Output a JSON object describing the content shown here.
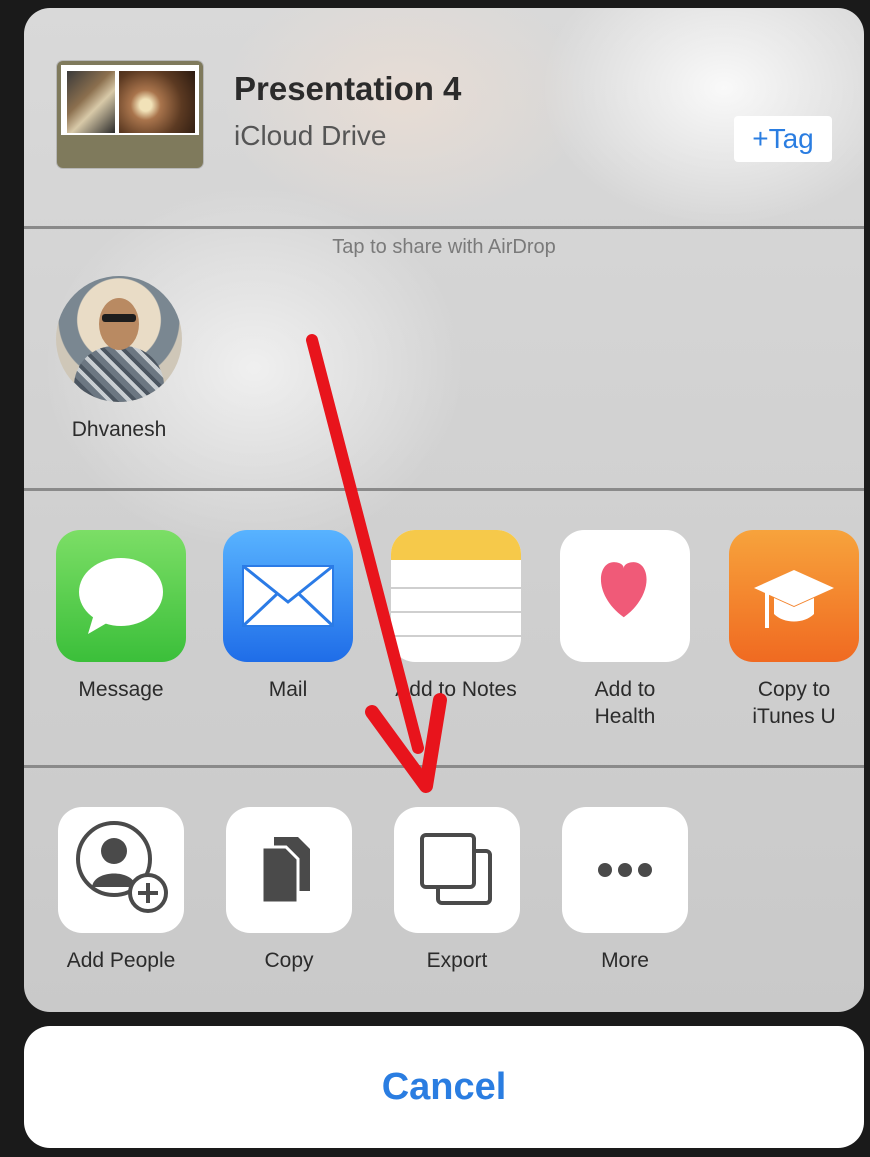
{
  "document": {
    "title": "Presentation 4",
    "location": "iCloud Drive",
    "tag_label": "+Tag"
  },
  "airdrop": {
    "hint": "Tap to share with AirDrop",
    "people": [
      {
        "name": "Dhvanesh"
      }
    ]
  },
  "apps": [
    {
      "label": "Message"
    },
    {
      "label": "Mail"
    },
    {
      "label": "Add to Notes"
    },
    {
      "label": "Add to\nHealth"
    },
    {
      "label": "Copy to\niTunes U"
    }
  ],
  "actions": [
    {
      "label": "Add People"
    },
    {
      "label": "Copy"
    },
    {
      "label": "Export"
    },
    {
      "label": "More"
    }
  ],
  "cancel_label": "Cancel",
  "colors": {
    "accent": "#2a7de1",
    "annotation_arrow": "#e8141c"
  }
}
